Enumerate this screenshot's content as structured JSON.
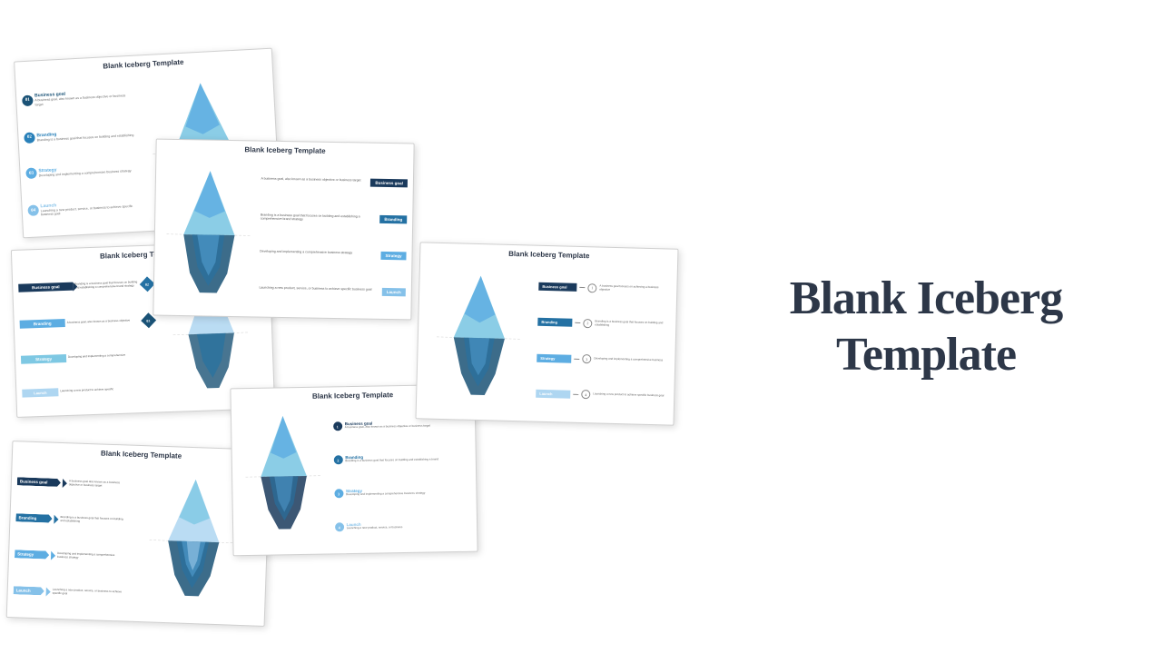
{
  "title": {
    "line1": "Blank Iceberg",
    "line2": "Template"
  },
  "cards": [
    {
      "id": 1,
      "title": "Blank Iceberg Template",
      "labels": [
        "Business goal",
        "Branding",
        "Strategy",
        "Launch"
      ],
      "numbers": [
        "01",
        "02",
        "03",
        "04"
      ]
    },
    {
      "id": 2,
      "title": "Blank Iceberg Template",
      "labels": [
        "Business goal",
        "Branding",
        "Strategy",
        "Launch"
      ]
    },
    {
      "id": 3,
      "title": "Blank Iceberg Template",
      "labels": [
        "Business goal",
        "Branding",
        "Strategy",
        "Launch"
      ]
    },
    {
      "id": 4,
      "title": "Blank Iceberg Template",
      "labels": [
        "Business goal",
        "Branding",
        "Strategy",
        "Launch"
      ]
    },
    {
      "id": 5,
      "title": "Blank Iceberg Template",
      "labels": [
        "Business goal",
        "Branding",
        "Strategy",
        "Launch"
      ]
    },
    {
      "id": 6,
      "title": "Blank Iceberg Template",
      "labels": [
        "Business goal",
        "Branding",
        "Strategy",
        "Launch"
      ]
    }
  ],
  "colors": {
    "dark_blue": "#1a3a5c",
    "mid_blue": "#2980b9",
    "light_blue": "#5dade2",
    "pale_blue": "#aed6f1",
    "iceberg_top": "#7ec8e3",
    "iceberg_bottom": "#1a5276",
    "title_color": "#2d3748"
  }
}
